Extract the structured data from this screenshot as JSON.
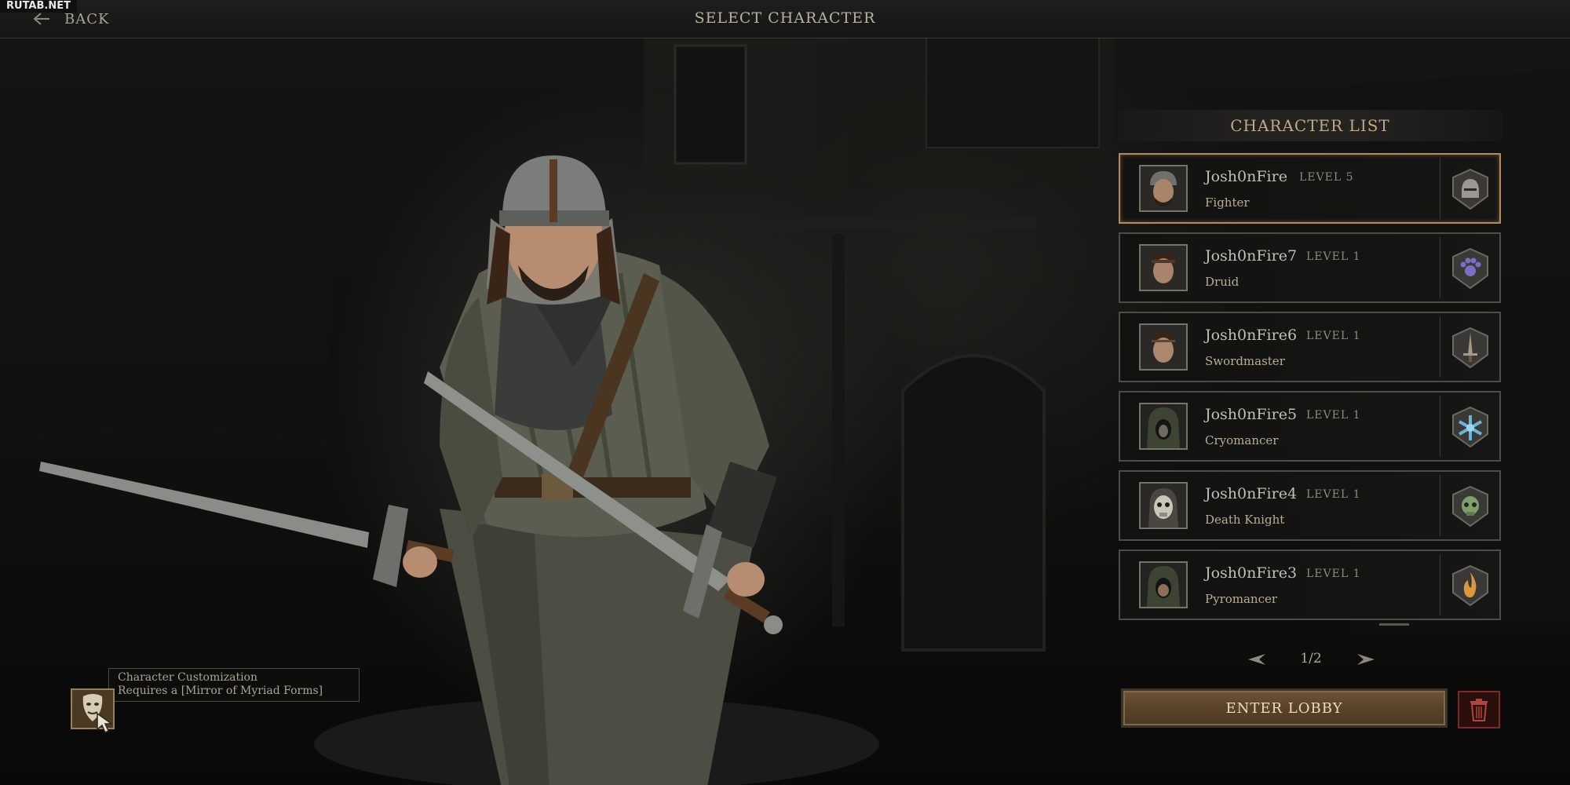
{
  "watermark": "RUTAB.NET",
  "header": {
    "back_label": "BACK",
    "title": "SELECT CHARACTER"
  },
  "character_list": {
    "title": "CHARACTER LIST",
    "selected_index": 0,
    "characters": [
      {
        "name": "Josh0nFire",
        "level": "LEVEL 5",
        "class": "Fighter",
        "class_icon": "fighter-helm-icon",
        "icon_color": "#9a9890"
      },
      {
        "name": "Josh0nFire7",
        "level": "LEVEL 1",
        "class": "Druid",
        "class_icon": "druid-paw-icon",
        "icon_color": "#7a6fc4"
      },
      {
        "name": "Josh0nFire6",
        "level": "LEVEL 1",
        "class": "Swordmaster",
        "class_icon": "swordmaster-blade-icon",
        "icon_color": "#a39a88"
      },
      {
        "name": "Josh0nFire5",
        "level": "LEVEL 1",
        "class": "Cryomancer",
        "class_icon": "cryomancer-snowflake-icon",
        "icon_color": "#6ab4d8"
      },
      {
        "name": "Josh0nFire4",
        "level": "LEVEL 1",
        "class": "Death Knight",
        "class_icon": "death-knight-skull-icon",
        "icon_color": "#7fa06a"
      },
      {
        "name": "Josh0nFire3",
        "level": "LEVEL 1",
        "class": "Pyromancer",
        "class_icon": "pyromancer-flame-icon",
        "icon_color": "#d89a3c"
      }
    ],
    "pagination": "1/2"
  },
  "actions": {
    "enter_lobby_label": "ENTER LOBBY",
    "delete_icon": "trash-icon"
  },
  "customization": {
    "icon": "mask-icon",
    "tooltip_line1": "Character Customization",
    "tooltip_line2": "Requires a [Mirror of Myriad Forms]"
  },
  "colors": {
    "accent_gold": "#b38a5b",
    "button_brown": "#5a4229",
    "delete_red": "#7a2b25"
  }
}
